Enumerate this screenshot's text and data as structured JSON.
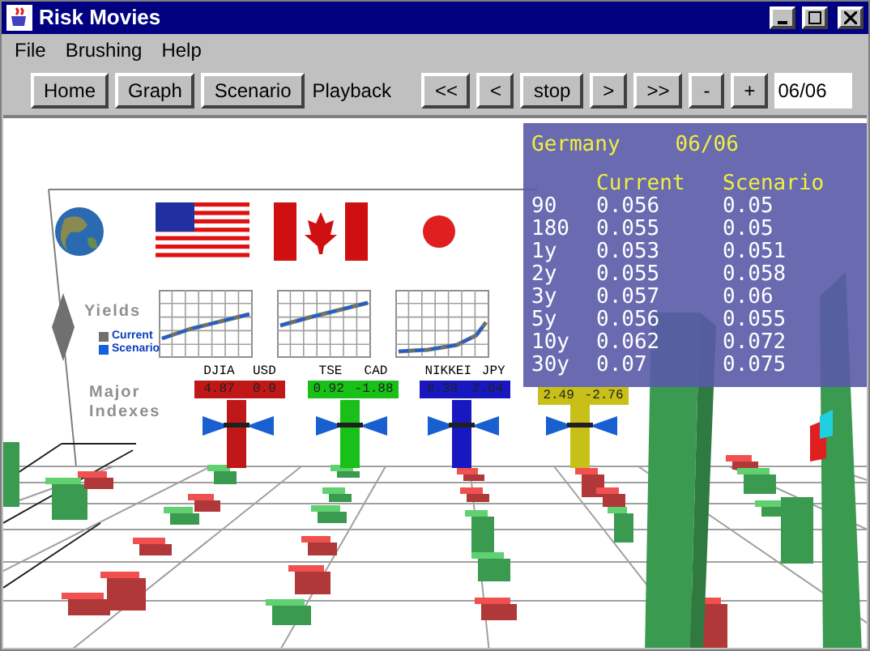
{
  "window": {
    "title": "Risk Movies"
  },
  "menu": [
    "File",
    "Brushing",
    "Help"
  ],
  "toolbar": [
    {
      "kind": "button",
      "label": "Home"
    },
    {
      "kind": "button",
      "label": "Graph"
    },
    {
      "kind": "button",
      "label": "Scenario"
    },
    {
      "kind": "label",
      "label": "Playback"
    },
    {
      "kind": "button",
      "label": "<<"
    },
    {
      "kind": "button",
      "label": "<"
    },
    {
      "kind": "button",
      "label": "stop"
    },
    {
      "kind": "button",
      "label": ">"
    },
    {
      "kind": "button",
      "label": ">>"
    },
    {
      "kind": "button",
      "label": "-"
    },
    {
      "kind": "button",
      "label": "+"
    },
    {
      "kind": "field",
      "value": "06/06"
    }
  ],
  "scene": {
    "countries": [
      {
        "kind": "globe"
      },
      {
        "kind": "us"
      },
      {
        "kind": "canada"
      },
      {
        "kind": "japan"
      }
    ],
    "yields_label": "Yields",
    "legend": [
      {
        "label": "Current",
        "color": "#707070"
      },
      {
        "label": "Scenario",
        "color": "#1060e0"
      }
    ],
    "indexes_label": "Major Indexes",
    "indexes": [
      {
        "labels": [
          "DJIA",
          "USD"
        ],
        "values": [
          "4.87",
          "0.0"
        ],
        "color": "#c01818"
      },
      {
        "labels": [
          "TSE",
          "CAD"
        ],
        "values": [
          "0.92",
          "-1.88"
        ],
        "color": "#18c018"
      },
      {
        "labels": [
          "NIKKEI",
          "JPY"
        ],
        "values": [
          "8.39",
          "2.04"
        ],
        "color": "#1818c0"
      },
      {
        "values": [
          "2.49",
          "-2.76"
        ],
        "color": "#c8c018"
      }
    ]
  },
  "detail": {
    "title": "Germany",
    "date": "06/06",
    "columns": [
      "Current",
      "Scenario"
    ],
    "rows": [
      {
        "term": "90",
        "current": "0.056",
        "scenario": "0.05"
      },
      {
        "term": "180",
        "current": "0.055",
        "scenario": "0.05"
      },
      {
        "term": "1y",
        "current": "0.053",
        "scenario": "0.051"
      },
      {
        "term": "2y",
        "current": "0.055",
        "scenario": "0.058"
      },
      {
        "term": "3y",
        "current": "0.057",
        "scenario": "0.06"
      },
      {
        "term": "5y",
        "current": "0.056",
        "scenario": "0.055"
      },
      {
        "term": "10y",
        "current": "0.062",
        "scenario": "0.072"
      },
      {
        "term": "30y",
        "current": "0.07",
        "scenario": "0.075"
      }
    ]
  }
}
